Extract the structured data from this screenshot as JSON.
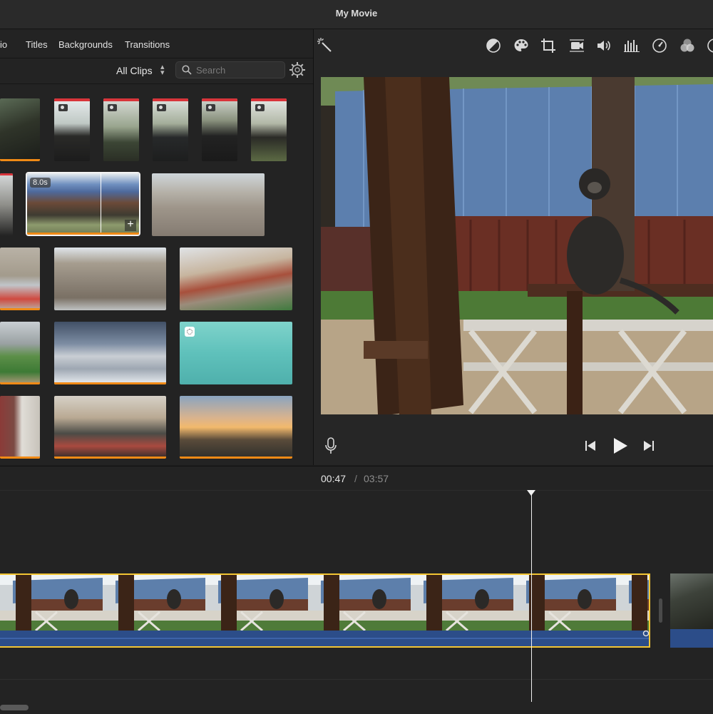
{
  "window": {
    "title": "My Movie"
  },
  "browser": {
    "nav": {
      "audio_partial": "io",
      "titles": "Titles",
      "backgrounds": "Backgrounds",
      "transitions": "Transitions"
    },
    "filter": {
      "all_clips": "All Clips",
      "search_placeholder": "Search"
    },
    "selected_clip_duration": "8.0s"
  },
  "timeline": {
    "current_time": "00:47",
    "separator": "/",
    "total_time": "03:57"
  },
  "colors": {
    "accent_yellow": "#f3c533",
    "audio_blue": "#2c4d89",
    "used_orange": "#f08a16",
    "favorite_red": "#d8343a"
  },
  "icons": [
    "magic-wand-icon",
    "color-balance-icon",
    "color-palette-icon",
    "crop-icon",
    "stabilization-icon",
    "volume-icon",
    "equalizer-icon",
    "speed-icon",
    "filter-icon",
    "microphone-icon",
    "skip-back-icon",
    "play-icon",
    "skip-forward-icon",
    "settings-icon",
    "search-icon",
    "plus-icon"
  ]
}
